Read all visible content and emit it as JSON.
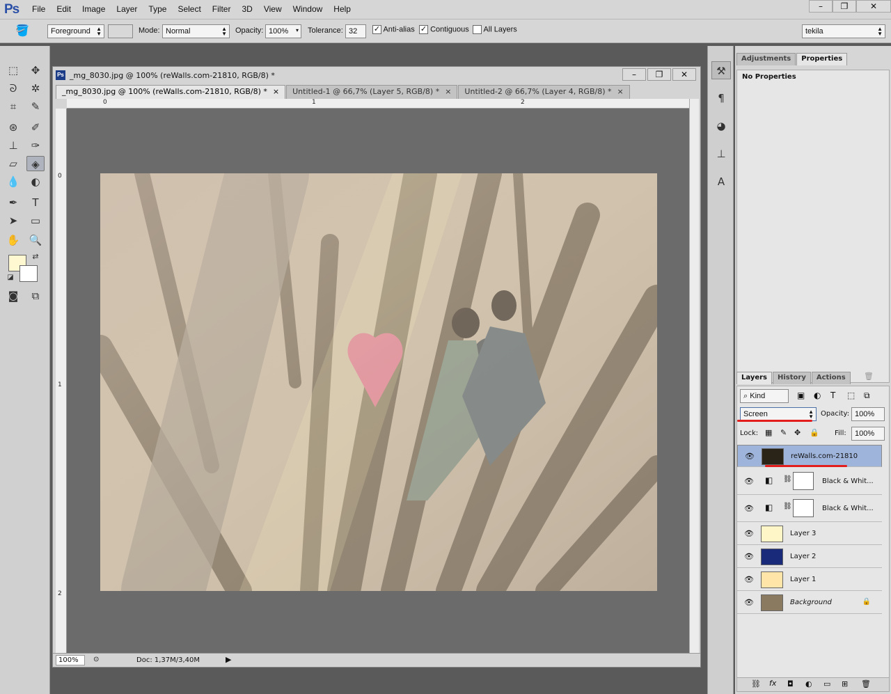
{
  "app": {
    "logo": "Ps"
  },
  "menu": [
    "File",
    "Edit",
    "Image",
    "Layer",
    "Type",
    "Select",
    "Filter",
    "3D",
    "View",
    "Window",
    "Help"
  ],
  "window_controls": {
    "minimize": "–",
    "restore": "❐",
    "close": "✕"
  },
  "options": {
    "fill_source": "Foreground",
    "mode_label": "Mode:",
    "mode_value": "Normal",
    "opacity_label": "Opacity:",
    "opacity_value": "100%",
    "tolerance_label": "Tolerance:",
    "tolerance_value": "32",
    "antialias_label": "Anti-alias",
    "contiguous_label": "Contiguous",
    "all_layers_label": "All Layers",
    "workspace": "tekila"
  },
  "document": {
    "title": "_mg_8030.jpg @ 100% (reWalls.com-21810, RGB/8) *",
    "tabs": [
      {
        "label": "_mg_8030.jpg @ 100% (reWalls.com-21810, RGB/8) *",
        "close": "×"
      },
      {
        "label": "Untitled-1 @ 66,7% (Layer 5, RGB/8) *",
        "close": "×"
      },
      {
        "label": "Untitled-2 @ 66,7% (Layer 4, RGB/8) *",
        "close": "×"
      }
    ],
    "ruler_h": [
      "0",
      "1",
      "2"
    ],
    "ruler_v": [
      "0",
      "1",
      "2"
    ],
    "zoom": "100%",
    "doc_info": "Doc: 1,37M/3,40M"
  },
  "panels": {
    "top_tabs": [
      "Adjustments",
      "Properties"
    ],
    "no_properties": "No Properties",
    "layer_tabs": [
      "Layers",
      "History",
      "Actions"
    ],
    "kind_label": "Kind",
    "blend_mode": "Screen",
    "opacity_label": "Opacity:",
    "opacity_value": "100%",
    "lock_label": "Lock:",
    "fill_label": "Fill:",
    "fill_value": "100%",
    "layers": [
      {
        "name": "reWalls.com-21810",
        "color": "#2a2418"
      },
      {
        "name": "Black & Whit...",
        "color": "#ffffff"
      },
      {
        "name": "Black & Whit...",
        "color": "#ffffff"
      },
      {
        "name": "Layer 3",
        "color": "#fff6c8"
      },
      {
        "name": "Layer 2",
        "color": "#1a2a7a"
      },
      {
        "name": "Layer 1",
        "color": "#ffe6a8"
      },
      {
        "name": "Background",
        "color": "#8a7a60"
      }
    ]
  }
}
